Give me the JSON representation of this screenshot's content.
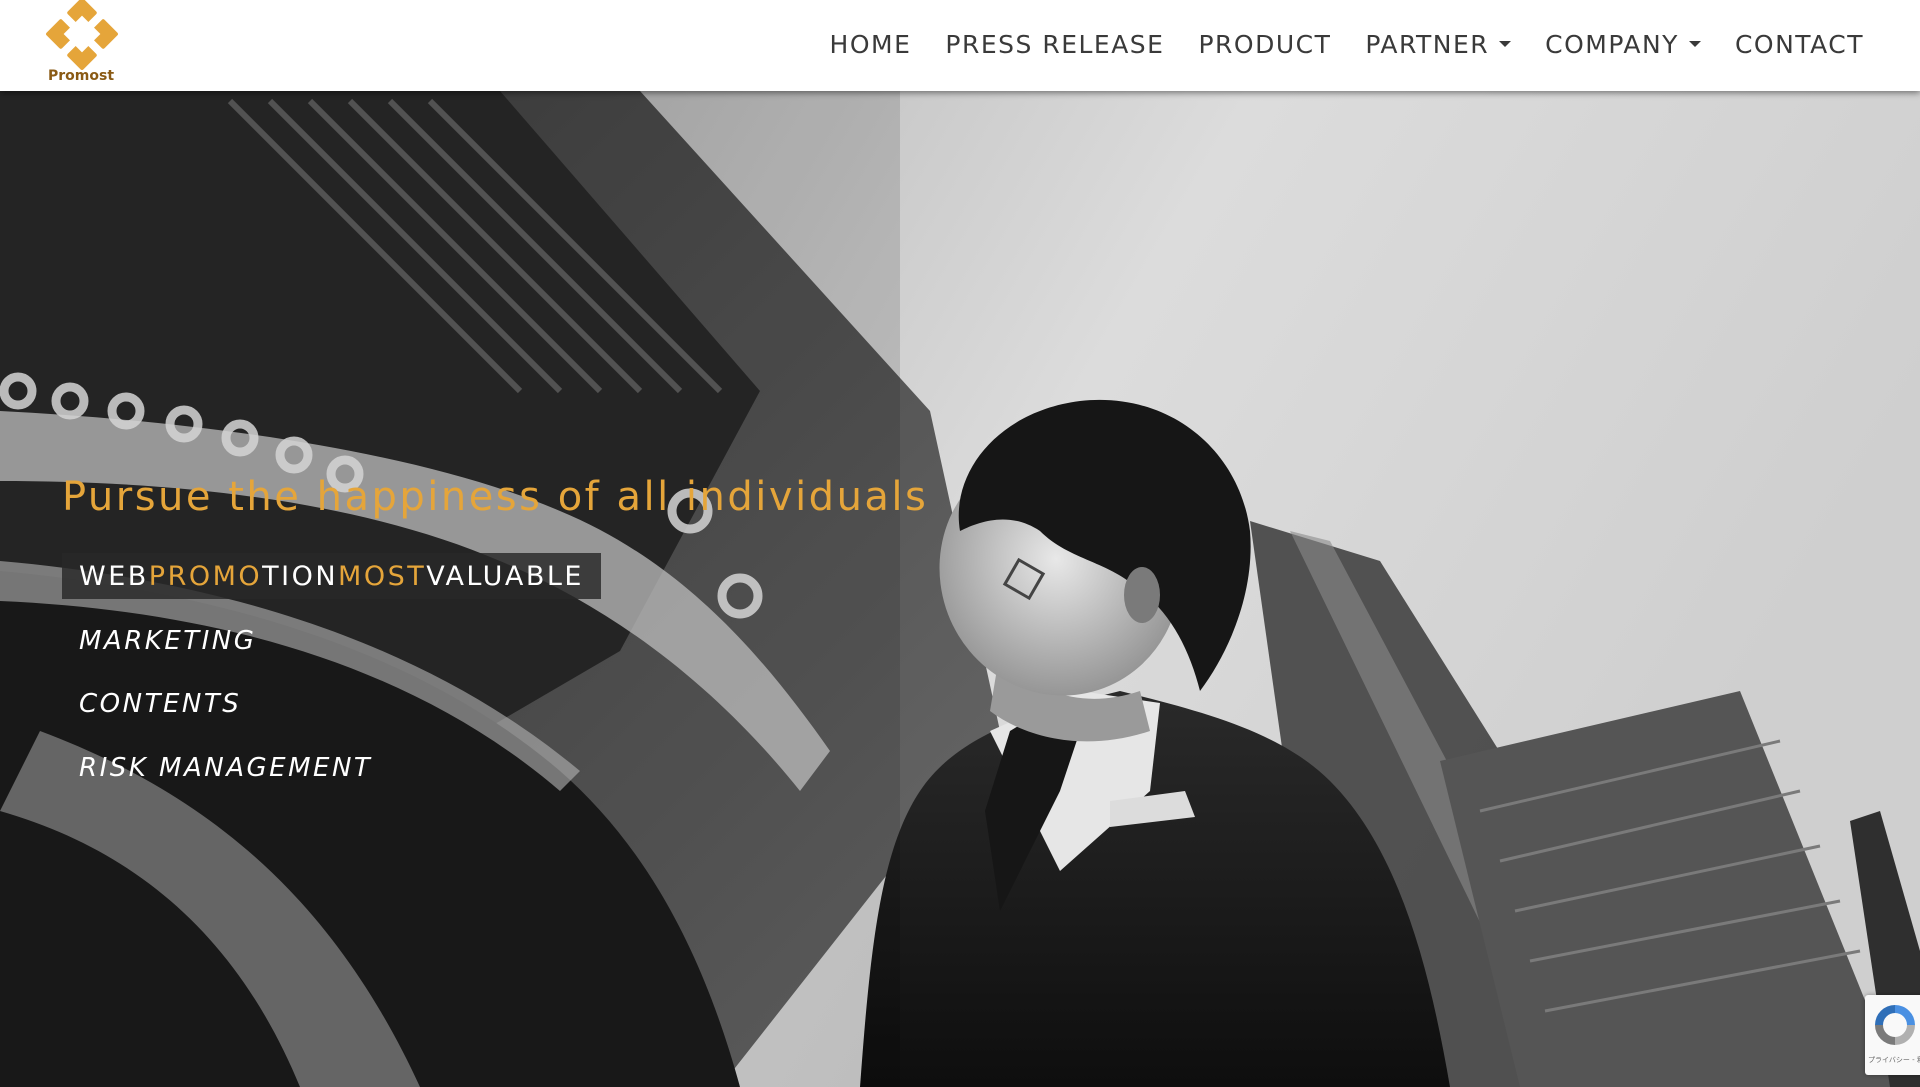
{
  "header": {
    "logo_text": "Promost",
    "nav": [
      {
        "label": "HOME",
        "has_dropdown": false
      },
      {
        "label": "PRESS RELEASE",
        "has_dropdown": false
      },
      {
        "label": "PRODUCT",
        "has_dropdown": false
      },
      {
        "label": "PARTNER",
        "has_dropdown": true
      },
      {
        "label": "COMPANY",
        "has_dropdown": true
      },
      {
        "label": "CONTACT",
        "has_dropdown": false
      }
    ]
  },
  "hero": {
    "tagline": "Pursue the happiness of all individuals",
    "brand_parts": [
      "WEB ",
      "PROMO",
      "TION ",
      "MOST",
      " VALUABLE"
    ],
    "services": [
      "MARKETING",
      "CONTENTS",
      "RISK MANAGEMENT"
    ]
  },
  "recaptcha": {
    "footer_text": "プライバシー - 利用規約"
  },
  "colors": {
    "accent": "#e5a53a",
    "nav_text": "#3a3a3a",
    "logo_text": "#8a5a14"
  }
}
